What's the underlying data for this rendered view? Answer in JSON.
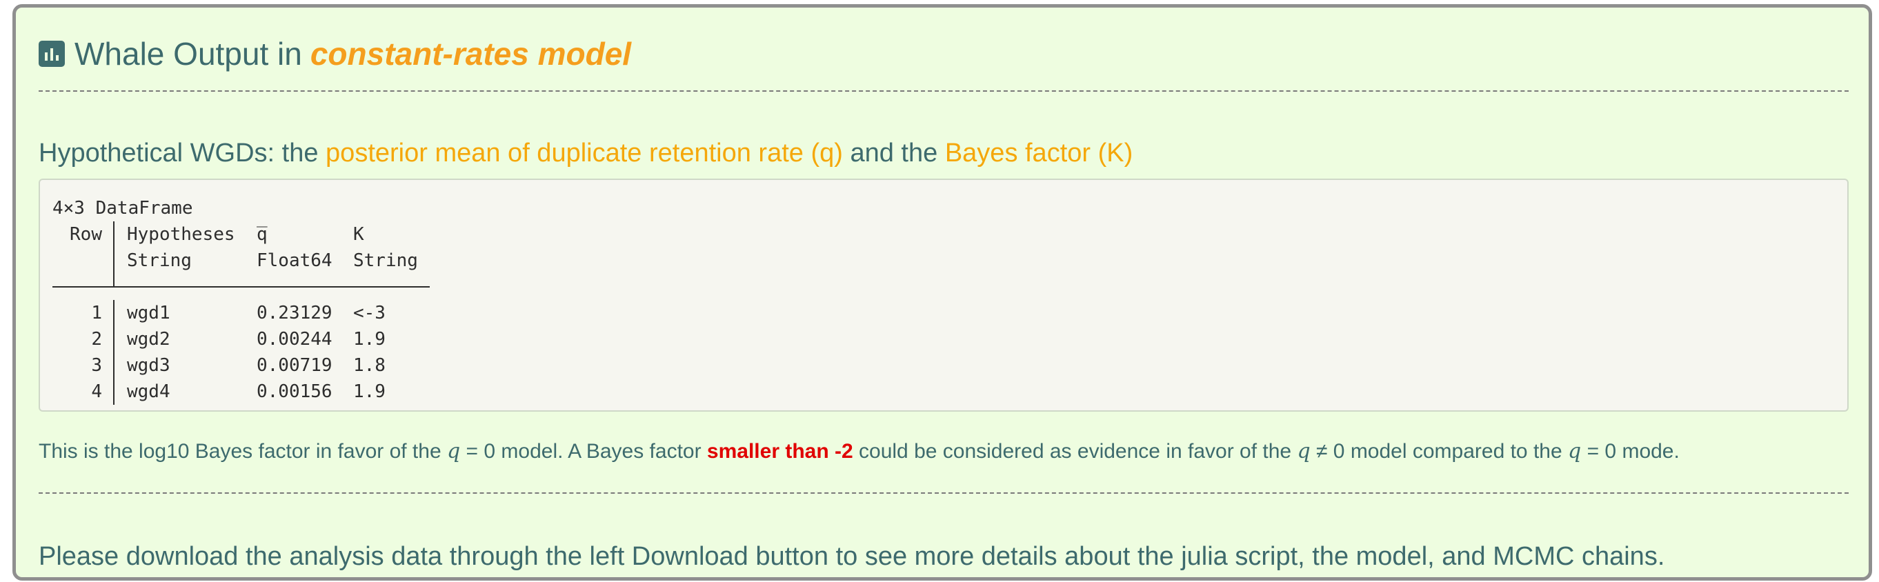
{
  "title": {
    "icon": "bar-chart-icon",
    "prefix": "Whale Output in",
    "model": "constant-rates model"
  },
  "subtitle": {
    "part1": "Hypothetical WGDs: the",
    "highlight1": "posterior mean of duplicate retention rate (q)",
    "part2": "and the",
    "highlight2": "Bayes factor (K)"
  },
  "dataframe": {
    "caption": "4×3 DataFrame",
    "headers": [
      "Row",
      "Hypotheses",
      "q̅",
      "K"
    ],
    "types": [
      "",
      "String",
      "Float64",
      "String"
    ],
    "rows": [
      [
        "1",
        "wgd1",
        "0.23129",
        "<-3"
      ],
      [
        "2",
        "wgd2",
        "0.00244",
        "1.9"
      ],
      [
        "3",
        "wgd3",
        "0.00719",
        "1.8"
      ],
      [
        "4",
        "wgd4",
        "0.00156",
        "1.9"
      ]
    ]
  },
  "note": {
    "part1": "This is the log10 Bayes factor in favor of the",
    "q1": "q",
    "part2": "= 0 model. A Bayes factor",
    "highlight": "smaller than -2",
    "part3": "could be considered as evidence in favor of the",
    "q2": "q",
    "part4": "≠ 0 model compared to the",
    "q3": "q",
    "part5": "= 0 mode."
  },
  "footer": {
    "text": "Please download the analysis data through the left Download button to see more details about the julia script, the model, and MCMC chains."
  },
  "colors": {
    "panel_bg": "#eefde0",
    "text": "#3d6a6d",
    "accent_orange": "#f59e1d",
    "accent_red": "#e00000"
  }
}
